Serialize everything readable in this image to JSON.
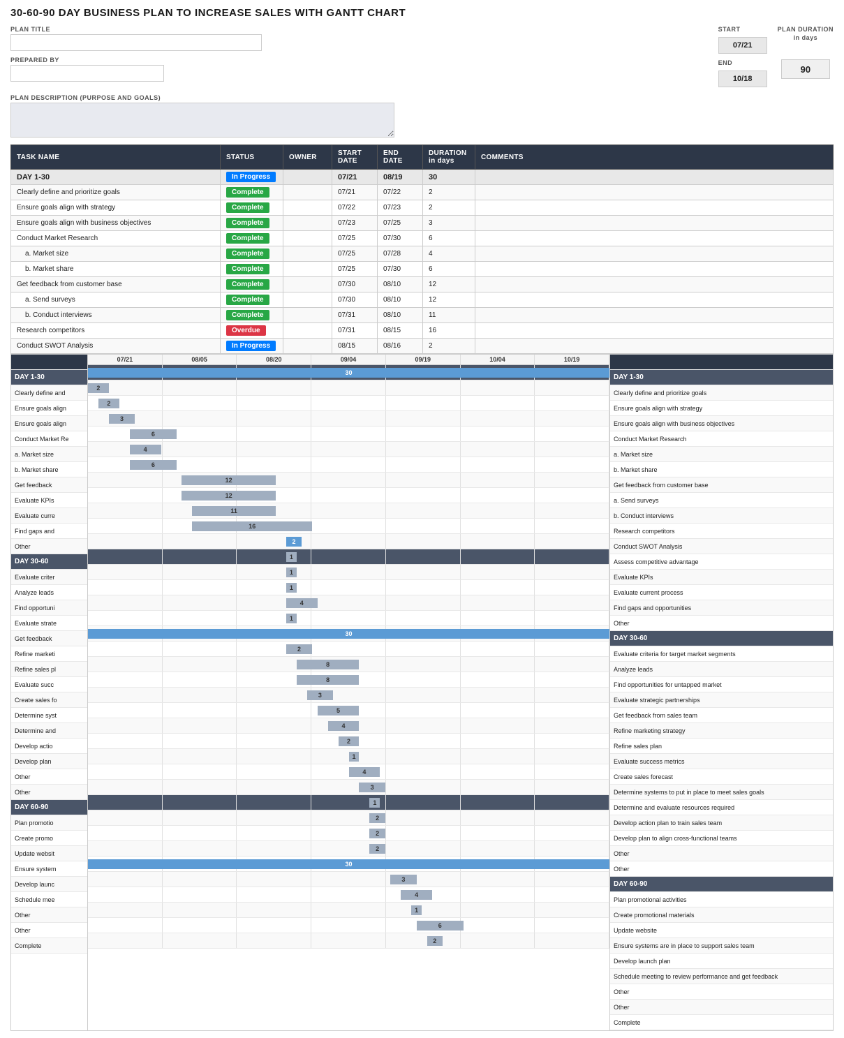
{
  "title": "30-60-90 DAY BUSINESS PLAN TO INCREASE SALES WITH GANTT CHART",
  "header": {
    "plan_title_label": "PLAN TITLE",
    "prepared_by_label": "PREPARED BY",
    "start_label": "START",
    "start_value": "07/21",
    "end_label": "END",
    "end_value": "10/18",
    "duration_label": "PLAN DURATION",
    "duration_sublabel": "in days",
    "duration_value": "90",
    "description_label": "PLAN DESCRIPTION (PURPOSE AND GOALS)"
  },
  "table": {
    "columns": [
      "TASK NAME",
      "STATUS",
      "OWNER",
      "START DATE",
      "END DATE",
      "DURATION in days",
      "COMMENTS"
    ],
    "rows": [
      {
        "name": "DAY 1-30",
        "status": "In Progress",
        "owner": "",
        "start": "07/21",
        "end": "08/19",
        "duration": "30",
        "comments": "",
        "type": "header"
      },
      {
        "name": "Clearly define and prioritize goals",
        "status": "Complete",
        "owner": "",
        "start": "07/21",
        "end": "07/22",
        "duration": "2",
        "comments": "",
        "type": "task"
      },
      {
        "name": "Ensure goals align with strategy",
        "status": "Complete",
        "owner": "",
        "start": "07/22",
        "end": "07/23",
        "duration": "2",
        "comments": "",
        "type": "task"
      },
      {
        "name": "Ensure goals align with business objectives",
        "status": "Complete",
        "owner": "",
        "start": "07/23",
        "end": "07/25",
        "duration": "3",
        "comments": "",
        "type": "task"
      },
      {
        "name": "Conduct Market Research",
        "status": "Complete",
        "owner": "",
        "start": "07/25",
        "end": "07/30",
        "duration": "6",
        "comments": "",
        "type": "task"
      },
      {
        "name": "a. Market size",
        "status": "Complete",
        "owner": "",
        "start": "07/25",
        "end": "07/28",
        "duration": "4",
        "comments": "",
        "type": "subtask"
      },
      {
        "name": "b. Market share",
        "status": "Complete",
        "owner": "",
        "start": "07/25",
        "end": "07/30",
        "duration": "6",
        "comments": "",
        "type": "subtask"
      },
      {
        "name": "Get feedback from customer base",
        "status": "Complete",
        "owner": "",
        "start": "07/30",
        "end": "08/10",
        "duration": "12",
        "comments": "",
        "type": "task"
      },
      {
        "name": "a. Send surveys",
        "status": "Complete",
        "owner": "",
        "start": "07/30",
        "end": "08/10",
        "duration": "12",
        "comments": "",
        "type": "subtask"
      },
      {
        "name": "b. Conduct interviews",
        "status": "Complete",
        "owner": "",
        "start": "07/31",
        "end": "08/10",
        "duration": "11",
        "comments": "",
        "type": "subtask"
      },
      {
        "name": "Research competitors",
        "status": "Overdue",
        "owner": "",
        "start": "07/31",
        "end": "08/15",
        "duration": "16",
        "comments": "",
        "type": "task"
      },
      {
        "name": "Conduct SWOT Analysis",
        "status": "In Progress",
        "owner": "",
        "start": "08/15",
        "end": "08/16",
        "duration": "2",
        "comments": "",
        "type": "task"
      }
    ]
  },
  "gantt": {
    "date_headers": [
      "07/21",
      "08/05",
      "08/20",
      "09/04",
      "09/19",
      "10/04",
      "10/19"
    ],
    "left_rows": [
      "DAY 1-30",
      "Clearly define and",
      "Ensure goals align",
      "Ensure goals align",
      "Conduct Market Re",
      "a. Market size",
      "b. Market share",
      "Get feedback",
      "Evaluate KPIs",
      "Evaluate curre",
      "Find gaps and",
      "Other",
      "DAY 30-60",
      "Evaluate criter",
      "Analyze leads",
      "Find opportuni",
      "Evaluate strate",
      "Get feedback",
      "Refine marketi",
      "Refine sales pl",
      "Evaluate succ",
      "Create sales fo",
      "Determine syst",
      "Determine and",
      "Develop actio",
      "Develop plan",
      "Other",
      "Other",
      "DAY 60-90",
      "Plan promotio",
      "Create promo",
      "Update websit",
      "Ensure system",
      "Develop launc",
      "Schedule mee",
      "Other",
      "Other",
      "Complete"
    ],
    "right_rows": [
      "DAY 1-30",
      "Clearly define and prioritize goals",
      "Ensure goals align with strategy",
      "Ensure goals align with business objectives",
      "Conduct Market Research",
      "a. Market size",
      "b. Market share",
      "Get feedback from customer base",
      "a. Send surveys",
      "b. Conduct interviews",
      "Research competitors",
      "Conduct SWOT Analysis",
      "Assess competitive advantage",
      "Evaluate KPIs",
      "Evaluate current process",
      "Find gaps and opportunities",
      "Other",
      "DAY 30-60",
      "Evaluate criteria for target market segments",
      "Analyze leads",
      "Find opportunities for untapped market",
      "Evaluate strategic partnerships",
      "Get feedback from sales team",
      "Refine marketing strategy",
      "Refine sales plan",
      "Evaluate success metrics",
      "Create sales forecast",
      "Determine systems to put in place to meet sales goals",
      "Determine and evaluate resources required",
      "Develop action plan to train sales team",
      "Develop plan to align cross-functional teams",
      "Other",
      "Other",
      "DAY 60-90",
      "Plan promotional activities",
      "Create promotional materials",
      "Update website",
      "Ensure systems are in place to support sales team",
      "Develop launch plan",
      "Schedule meeting to review performance and get feedback",
      "Other",
      "Other",
      "Complete"
    ],
    "bars": [
      {
        "row": 0,
        "left_pct": 0,
        "width_pct": 100,
        "value": "30",
        "color": "blue"
      },
      {
        "row": 1,
        "left_pct": 0,
        "width_pct": 3,
        "value": "2",
        "color": "gray"
      },
      {
        "row": 2,
        "left_pct": 1,
        "width_pct": 3,
        "value": "2",
        "color": "gray"
      },
      {
        "row": 3,
        "left_pct": 2,
        "width_pct": 4,
        "value": "3",
        "color": "gray"
      },
      {
        "row": 4,
        "left_pct": 4,
        "width_pct": 9,
        "value": "6",
        "color": "gray"
      },
      {
        "row": 5,
        "left_pct": 4,
        "width_pct": 6,
        "value": "4",
        "color": "gray"
      },
      {
        "row": 6,
        "left_pct": 4,
        "width_pct": 9,
        "value": "6",
        "color": "gray"
      },
      {
        "row": 7,
        "left_pct": 13,
        "width_pct": 17,
        "value": "12",
        "color": "gray"
      },
      {
        "row": 8,
        "left_pct": 13,
        "width_pct": 17,
        "value": "12",
        "color": "gray"
      },
      {
        "row": 9,
        "left_pct": 14,
        "width_pct": 16,
        "value": "11",
        "color": "gray"
      },
      {
        "row": 10,
        "left_pct": 14,
        "width_pct": 22,
        "value": "16",
        "color": "gray"
      },
      {
        "row": 11,
        "left_pct": 28,
        "width_pct": 3,
        "value": "2",
        "color": "blue"
      }
    ]
  }
}
